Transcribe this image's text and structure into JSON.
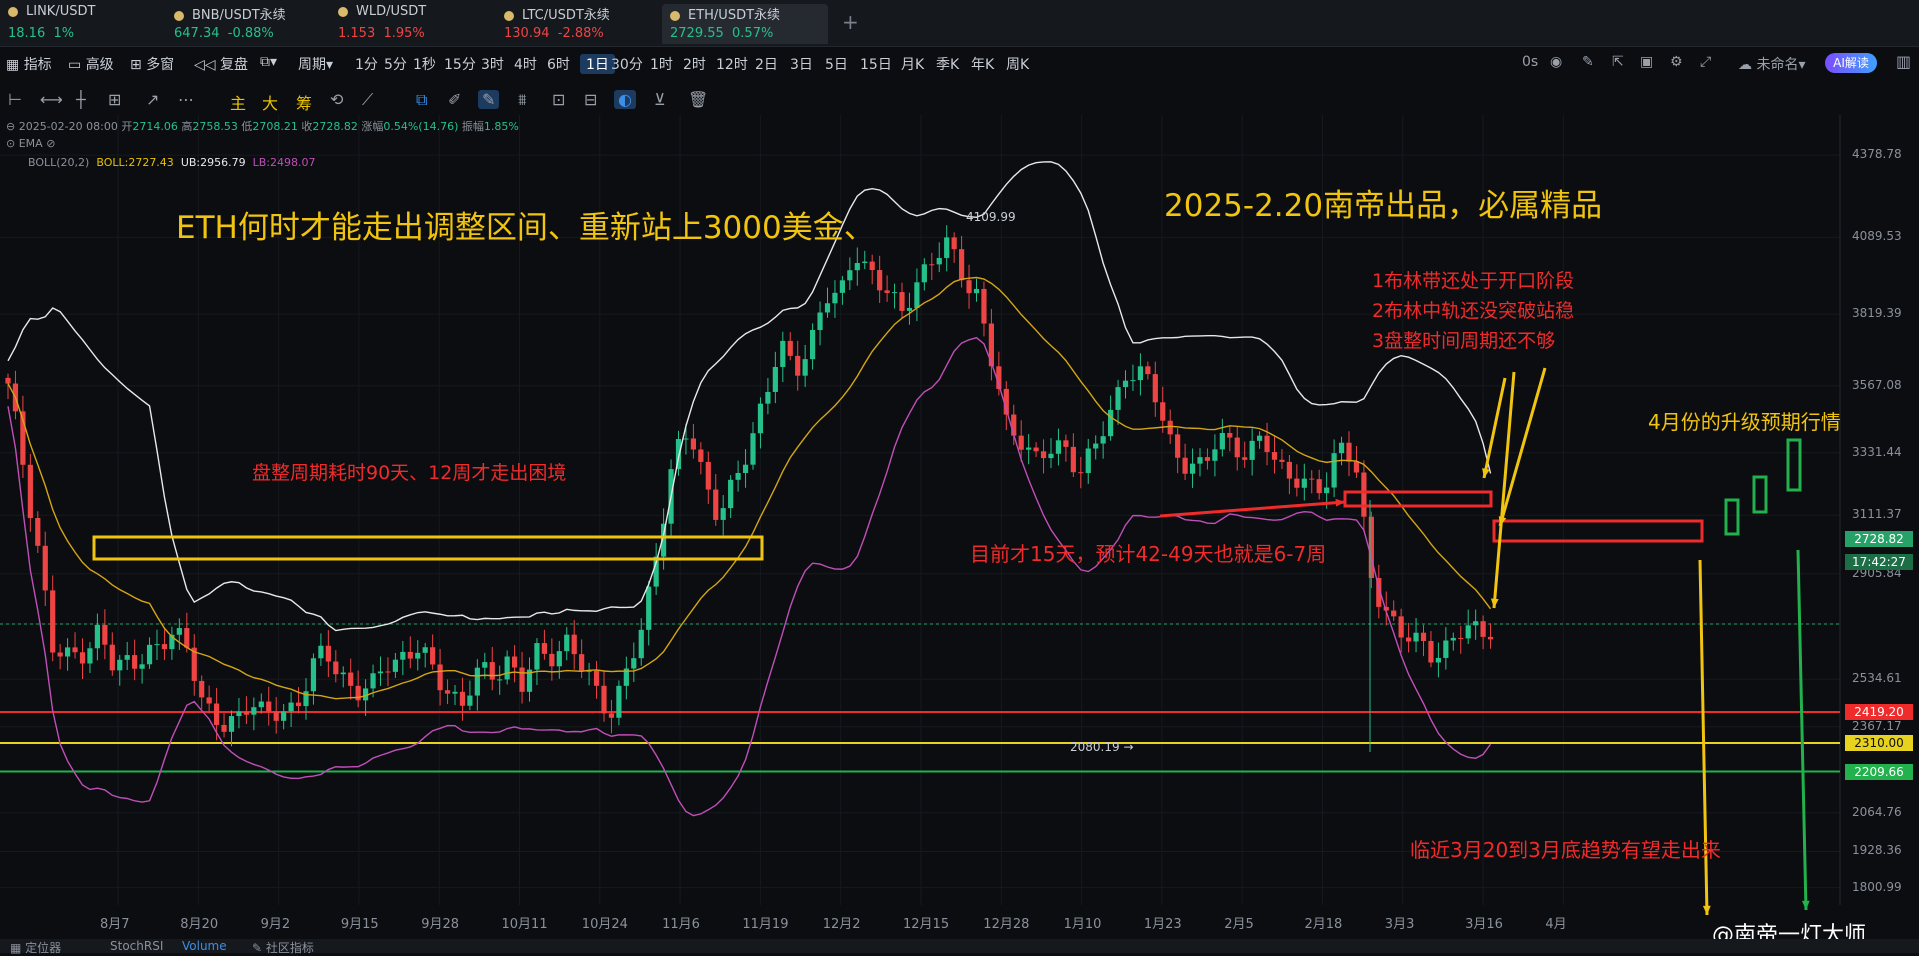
{
  "tabs": [
    {
      "name": "LINK/USDT",
      "price": "18.16",
      "change": "1%",
      "color": "#26c08a",
      "x": 6
    },
    {
      "name": "BNB/USDT永续",
      "price": "647.34",
      "change": "-0.88%",
      "color": "#26c08a",
      "x": 172
    },
    {
      "name": "WLD/USDT",
      "price": "1.153",
      "change": "1.95%",
      "color": "#ef4444",
      "x": 336
    },
    {
      "name": "LTC/USDT永续",
      "price": "130.94",
      "change": "-2.88%",
      "color": "#ef4444",
      "x": 502
    },
    {
      "name": "ETH/USDT永续",
      "price": "2729.55",
      "change": "0.57%",
      "color": "#26c08a",
      "x": 668,
      "active": true
    }
  ],
  "toolbar": {
    "left": [
      "指标",
      "高级",
      "多窗",
      "复盘",
      "周期"
    ],
    "periods": [
      "1分",
      "5分",
      "1秒",
      "15分",
      "3时",
      "4时",
      "6时",
      "1日",
      "30分",
      "1时",
      "2时",
      "12时",
      "2日",
      "3日",
      "5日",
      "15日",
      "月K",
      "季K",
      "年K",
      "周K"
    ],
    "active_period": "1日",
    "countdown": "0s",
    "unnamed": "未命名",
    "ai": "AI解读"
  },
  "drawbar": {
    "labels": [
      "主",
      "大",
      "筹"
    ]
  },
  "ohlc": {
    "date": "2025-02-20 08:00",
    "open_label": "开",
    "open": "2714.06",
    "high_label": "高",
    "high": "2758.53",
    "low_label": "低",
    "low": "2708.21",
    "close_label": "收",
    "close": "2728.82",
    "chg_label": "涨幅",
    "chg": "0.54%(14.76)",
    "amp_label": "振幅",
    "amp": "1.85%"
  },
  "indicators": {
    "ema": "EMA",
    "boll": "BOLL(20,2)",
    "boll_mid": "BOLL:2727.43",
    "boll_ub": "UB:2956.79",
    "boll_lb": "LB:2498.07"
  },
  "chart_data": {
    "type": "candlestick",
    "symbol": "ETH/USDT永续",
    "interval": "1日",
    "x_ticks": [
      "8月7",
      "8月20",
      "9月2",
      "9月15",
      "9月28",
      "10月11",
      "10月24",
      "11月6",
      "11月19",
      "12月2",
      "12月15",
      "12月28",
      "1月10",
      "1月23",
      "2月5",
      "2月18",
      "3月3",
      "3月16",
      "4月"
    ],
    "y_ticks": [
      4378.78,
      4089.53,
      3819.39,
      3567.08,
      3331.44,
      3111.37,
      2905.84,
      2728.82,
      2534.61,
      2367.17,
      2064.76,
      1928.36,
      1800.99
    ],
    "ylim": [
      1740,
      4520
    ],
    "last_price": 2728.82,
    "countdown": "17:42:27",
    "high_mark": "4109.99",
    "low_mark": "2080.19",
    "hlines": [
      {
        "value": 2419.2,
        "label": "2419.20",
        "color": "#ef2b2b"
      },
      {
        "value": 2310.0,
        "label": "2310.00",
        "color": "#e6d21f"
      },
      {
        "value": 2209.66,
        "label": "2209.66",
        "color": "#22b14c"
      }
    ]
  },
  "annotations": {
    "title": "ETH何时才能走出调整区间、重新站上3000美金、",
    "brand": "2025-2.20南帝出品，必属精品",
    "consolidation": "盘整周期耗时90天、12周才走出困境",
    "current": "目前才15天，预计42-49天也就是6-7周",
    "points": [
      "1布林带还处于开口阶段",
      "2布林中轨还没突破站稳",
      "3盘整时间周期还不够"
    ],
    "april": "4月份的升级预期行情",
    "late_march": "临近3月20到3月底趋势有望走出来",
    "watermark": "@南帝一灯大师"
  },
  "bottom": {
    "items": [
      "定位器",
      "StochRSI",
      "Volume",
      "社区指标"
    ]
  }
}
